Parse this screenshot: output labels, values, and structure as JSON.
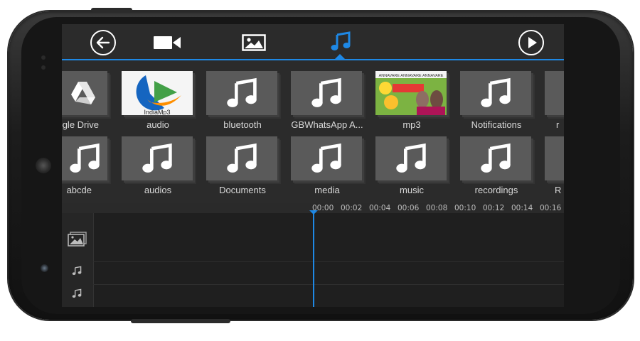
{
  "header": {
    "tabs": [
      {
        "icon": "video-camera-icon",
        "active": false
      },
      {
        "icon": "image-icon",
        "active": false
      },
      {
        "icon": "music-note-icon",
        "active": true
      }
    ],
    "back_icon": "back-arrow-icon",
    "play_icon": "play-icon",
    "accent_color": "#1e88e5"
  },
  "folders_row1": [
    {
      "label": "ogle Drive",
      "icon": "google-drive-icon"
    },
    {
      "label": "audio",
      "icon": "thumbnail-image",
      "thumb_text": "IndiaMp3"
    },
    {
      "label": "bluetooth",
      "icon": "music-note-icon"
    },
    {
      "label": "GBWhatsApp A...",
      "icon": "music-note-icon"
    },
    {
      "label": "mp3",
      "icon": "thumbnail-image",
      "thumb_text": "ANNAVARE ANNAVARE ANNAVARE"
    },
    {
      "label": "Notifications",
      "icon": "music-note-icon"
    },
    {
      "label": "r",
      "icon": "music-note-icon"
    }
  ],
  "folders_row2": [
    {
      "label": "abcde",
      "icon": "music-note-icon"
    },
    {
      "label": "audios",
      "icon": "music-note-icon"
    },
    {
      "label": "Documents",
      "icon": "music-note-icon"
    },
    {
      "label": "media",
      "icon": "music-note-icon"
    },
    {
      "label": "music",
      "icon": "music-note-icon"
    },
    {
      "label": "recordings",
      "icon": "music-note-icon"
    },
    {
      "label": "R",
      "icon": "music-note-icon"
    }
  ],
  "timeline": {
    "ticks": [
      "00:00",
      "00:02",
      "00:04",
      "00:06",
      "00:08",
      "00:10",
      "00:12",
      "00:14",
      "00:16"
    ],
    "tracks": [
      {
        "icon": "image-track-icon"
      },
      {
        "icon": "audio-track-icon"
      },
      {
        "icon": "audio-track-icon"
      }
    ]
  }
}
